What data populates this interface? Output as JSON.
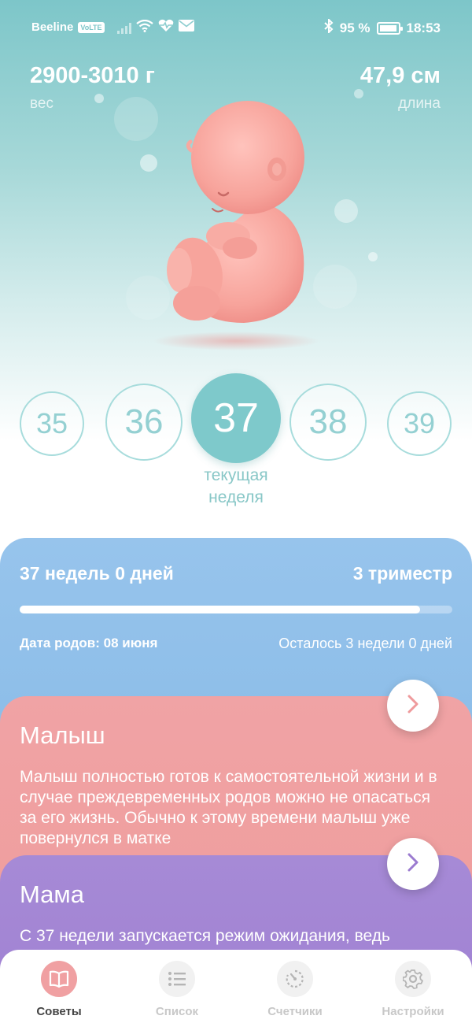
{
  "status_bar": {
    "carrier": "Beeline",
    "volte": "VoLTE",
    "battery": "95 %",
    "time": "18:53"
  },
  "metrics": {
    "weight_value": "2900-3010 г",
    "weight_label": "вес",
    "length_value": "47,9 см",
    "length_label": "длина"
  },
  "weeks": {
    "items": [
      "35",
      "36",
      "37",
      "38",
      "39"
    ],
    "current": "37",
    "current_label_line1": "текущая",
    "current_label_line2": "неделя"
  },
  "progress": {
    "title": "37 недель 0 дней",
    "trimester": "3 триместр",
    "fraction": 0.925,
    "due_date": "Дата родов: 08 июня",
    "remaining": "Осталось 3 недели 0 дней"
  },
  "baby_card": {
    "title": "Малыш",
    "body": "Малыш полностью готов к самостоятельной жизни и в случае преждевременных родов можно не опасаться за его жизнь. Обычно к этому времени малыш уже повернулся в матке"
  },
  "mama_card": {
    "title": "Мама",
    "body": "С 37 недели запускается режим ожидания, ведь"
  },
  "nav": {
    "items": [
      {
        "label": "Советы",
        "icon": "book-icon",
        "active": true
      },
      {
        "label": "Список",
        "icon": "list-icon",
        "active": false
      },
      {
        "label": "Счетчики",
        "icon": "timer-icon",
        "active": false
      },
      {
        "label": "Настройки",
        "icon": "gear-icon",
        "active": false
      }
    ]
  },
  "colors": {
    "teal": "#7ec9cb",
    "blue_card": "#97c4ec",
    "pink_card": "#f0a3a5",
    "purple_card": "#a68ad6"
  }
}
